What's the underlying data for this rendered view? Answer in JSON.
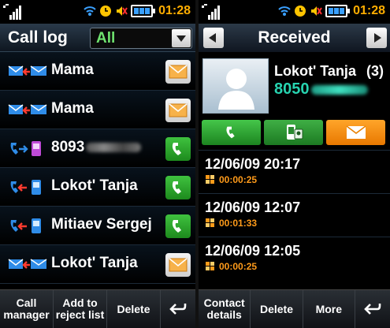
{
  "left": {
    "status": {
      "time": "01:28"
    },
    "header": {
      "title": "Call log",
      "filter_value": "All"
    },
    "rows": [
      {
        "type": "message",
        "name": "Mama",
        "action": "message"
      },
      {
        "type": "message",
        "name": "Mama",
        "action": "message"
      },
      {
        "type": "call",
        "name": "8093",
        "blurred": true,
        "action": "call"
      },
      {
        "type": "call",
        "name": "Lokot' Tanja",
        "action": "call"
      },
      {
        "type": "call",
        "name": "Mitiaev Sergej",
        "action": "call"
      },
      {
        "type": "message",
        "name": "Lokot' Tanja",
        "action": "message"
      }
    ],
    "softkeys": {
      "call_manager": "Call manager",
      "add_reject": "Add to reject list",
      "delete": "Delete"
    }
  },
  "right": {
    "status": {
      "time": "01:28"
    },
    "header": {
      "title": "Received"
    },
    "contact": {
      "name": "Lokot' Tanja",
      "count": "(3)",
      "number": "8050"
    },
    "entries": [
      {
        "datetime": "12/06/09 20:17",
        "duration": "00:00:25"
      },
      {
        "datetime": "12/06/09 12:07",
        "duration": "00:01:33"
      },
      {
        "datetime": "12/06/09 12:05",
        "duration": "00:00:25"
      }
    ],
    "softkeys": {
      "contact_details": "Contact details",
      "delete": "Delete",
      "more": "More"
    }
  },
  "colors": {
    "clock": "#ffae00",
    "filter": "#6fe36f",
    "number": "#27d3b0",
    "duration": "#ff9b1a",
    "call_green": "#2ea832",
    "msg_orange": "#f08a10"
  }
}
